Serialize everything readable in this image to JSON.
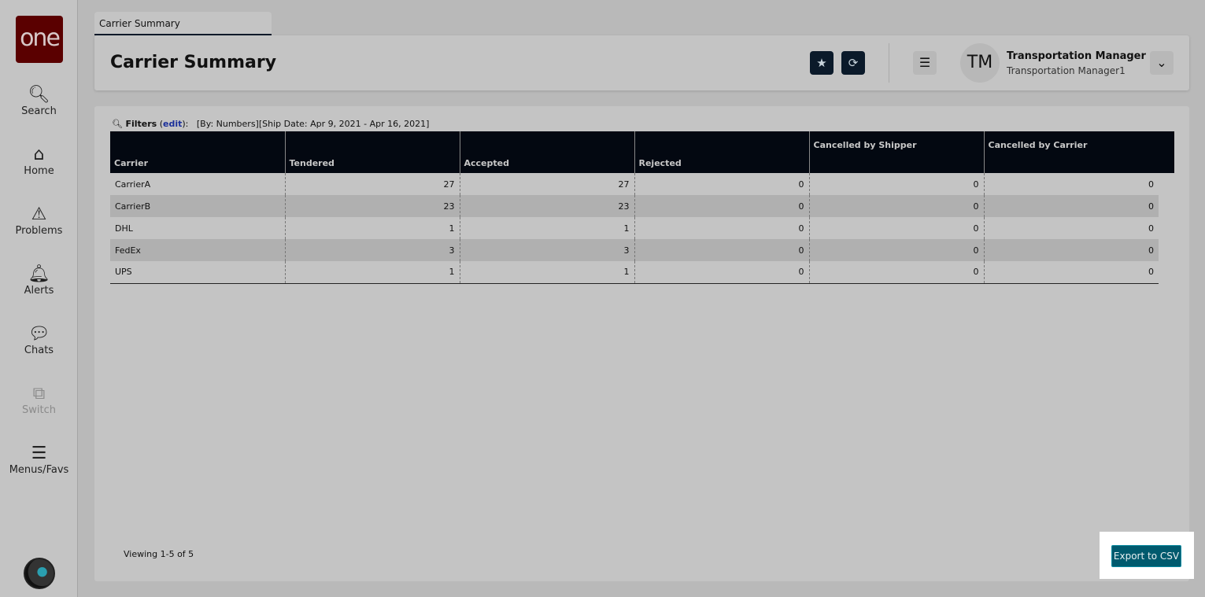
{
  "sidebar": {
    "logo": "one",
    "items": [
      {
        "label": "Search",
        "icon": "search-icon"
      },
      {
        "label": "Home",
        "icon": "home-icon"
      },
      {
        "label": "Problems",
        "icon": "warning-icon"
      },
      {
        "label": "Alerts",
        "icon": "bell-icon"
      },
      {
        "label": "Chats",
        "icon": "chat-icon"
      },
      {
        "label": "Switch",
        "icon": "switch-icon"
      },
      {
        "label": "Menus/Favs",
        "icon": "menu-icon"
      }
    ]
  },
  "tab": {
    "label": "Carrier Summary"
  },
  "header": {
    "title": "Carrier Summary",
    "user_initials": "TM",
    "user_name": "Transportation Manager",
    "user_role": "Transportation Manager1"
  },
  "filters": {
    "label": "Filters",
    "edit": "edit",
    "value": "[By: Numbers][Ship Date: Apr 9, 2021 - Apr 16, 2021]"
  },
  "table": {
    "columns": [
      "Carrier",
      "Tendered",
      "Accepted",
      "Rejected",
      "Cancelled by Shipper",
      "Cancelled by Carrier"
    ],
    "rows": [
      [
        "CarrierA",
        "27",
        "27",
        "0",
        "0",
        "0"
      ],
      [
        "CarrierB",
        "23",
        "23",
        "0",
        "0",
        "0"
      ],
      [
        "DHL",
        "1",
        "1",
        "0",
        "0",
        "0"
      ],
      [
        "FedEx",
        "3",
        "3",
        "0",
        "0",
        "0"
      ],
      [
        "UPS",
        "1",
        "1",
        "0",
        "0",
        "0"
      ]
    ]
  },
  "footer": {
    "viewing": "Viewing 1-5 of 5",
    "export": "Export to CSV"
  }
}
